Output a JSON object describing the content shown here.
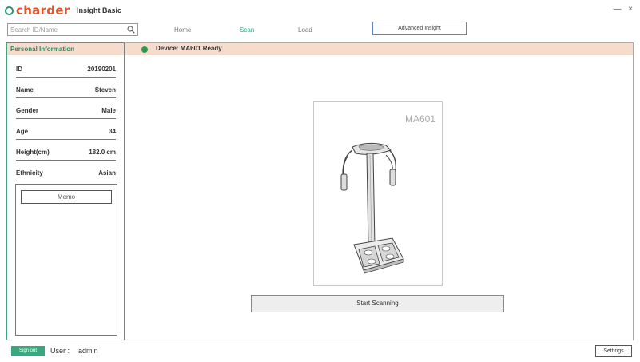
{
  "app": {
    "logo_text": "charder",
    "title": "Insight Basic",
    "window_controls": "— ×"
  },
  "search": {
    "placeholder": "Search ID/Name",
    "value": ""
  },
  "nav": {
    "home": "Home",
    "scan": "Scan",
    "load": "Load",
    "advanced": "Advanced Insight",
    "active_color": "#2eae7e"
  },
  "personal": {
    "header": "Personal Information",
    "rows": [
      {
        "label": "ID",
        "value": "20190201"
      },
      {
        "label": "Name",
        "value": "Steven"
      },
      {
        "label": "Gender",
        "value": "Male"
      },
      {
        "label": "Age",
        "value": "34"
      },
      {
        "label": "Height(cm)",
        "value": "182.0 cm"
      },
      {
        "label": "Ethnicity",
        "value": "Asian"
      }
    ],
    "memo_label": "Memo"
  },
  "device": {
    "status_text": "Device: MA601 Ready",
    "status_color": "#2f9a50",
    "model": "MA601"
  },
  "actions": {
    "start_scan": "Start Scanning",
    "sign_out": "Sign out",
    "settings": "Settings"
  },
  "user": {
    "label": "User :",
    "name": "admin"
  },
  "colors": {
    "brand_orange": "#e0542a",
    "brand_green": "#3aa87c",
    "header_bg": "#f6dccd"
  }
}
